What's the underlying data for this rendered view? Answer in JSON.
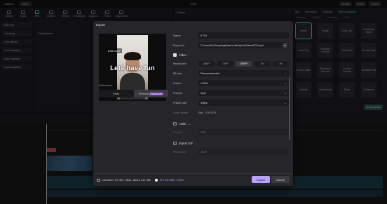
{
  "app": {
    "brand": "CapCut",
    "menu_label": "Menu",
    "window_title": "0710",
    "title_right": [
      "Modify",
      "Share",
      "Export"
    ]
  },
  "toolbar": {
    "tools": [
      {
        "label": "Media",
        "icon": "media-icon"
      },
      {
        "label": "Audio",
        "icon": "audio-icon"
      },
      {
        "label": "Text",
        "icon": "text-icon",
        "active": true
      },
      {
        "label": "Stickers",
        "icon": "sticker-icon"
      },
      {
        "label": "Effects",
        "icon": "effects-icon"
      },
      {
        "label": "Transitions",
        "icon": "transitions-icon"
      },
      {
        "label": "Captions",
        "icon": "captions-icon"
      },
      {
        "label": "Filters",
        "icon": "filters-icon"
      },
      {
        "label": "Adjustment",
        "icon": "adjustment-icon"
      }
    ]
  },
  "left_panel": {
    "items": [
      "Add text",
      "Trending",
      "Text effects",
      "Text template",
      "Auto captions",
      "Local captions"
    ]
  },
  "media_panel": {
    "default_text": "Default text"
  },
  "player": {
    "title": "Player"
  },
  "right_panel": {
    "tabs": [
      "Text",
      "Animation",
      "Tracking",
      "Text-to-speech"
    ],
    "active_tab": "Text-to-speech",
    "subtabs": [
      "Trending",
      "English",
      "Narrator",
      "Music"
    ],
    "voices": [
      "Jessie",
      "Bestie",
      "Cute boy",
      "Charming Male",
      "Good Guy",
      "Peaceful Female",
      "Valley Girl",
      "Female Tutor",
      "Serious Male",
      "Storyteller Female",
      "Excited Female",
      "Adorable Girl",
      "Michael",
      "Chica Wood",
      "Elder",
      "Professor"
    ],
    "set_default": "Set as default"
  },
  "dialog": {
    "title": "Export",
    "edit_cover": "Edit cover",
    "caption": "Lets have fun",
    "watermark_label": "Watermark",
    "watermark_options": [
      "Keep",
      "Remove"
    ],
    "watermark_selected": "Remove",
    "remove_badge": "3 free/month",
    "name_label": "Name",
    "name_value": "0710",
    "export_to_label": "Export to",
    "export_to_value": "C:/Users/S A Group/AppData/Local/CapCut/Videos/0710.mp4",
    "video_section": "Video",
    "resolution_label": "Resolution",
    "resolutions": [
      "480P",
      "720P",
      "1080P",
      "2K",
      "4K"
    ],
    "resolution_selected": "1080P",
    "bitrate_label": "Bit rate",
    "bitrate_value": "Recommended",
    "codec_label": "Codec",
    "codec_value": "H.264",
    "format_label": "Format",
    "format_value": "mp4",
    "framerate_label": "Frame rate",
    "framerate_value": "30fps",
    "color_space_label": "Color space",
    "color_space_value": "Rec. 709 SDR",
    "audio_section": "Audio",
    "audio_format_label": "Format",
    "audio_format_value": "MP3",
    "gif_section": "Export GIF",
    "gif_res_label": "Resolution",
    "gif_res_value": "240P",
    "footer_info": "Duration: 1m 32s | Size: about 141 MB",
    "pro_label": "Pro benefits: 1 item",
    "export_button": "Export",
    "cancel_button": "Cancel"
  }
}
